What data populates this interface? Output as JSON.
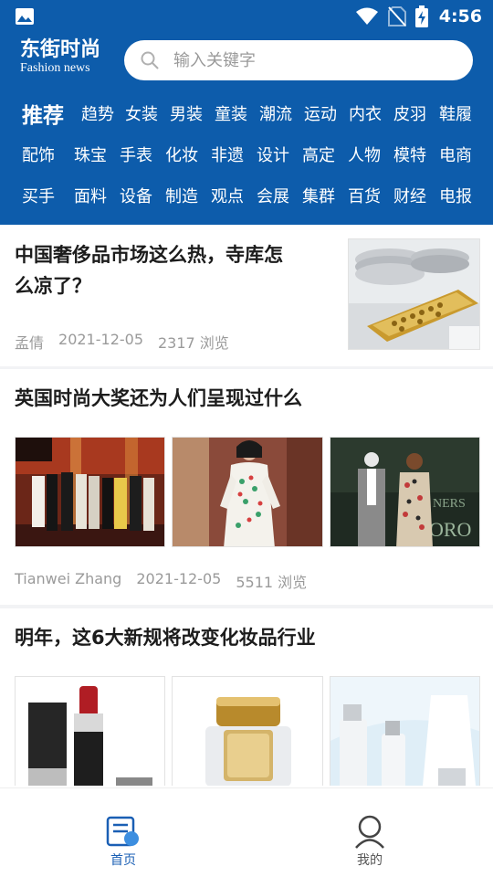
{
  "status_bar": {
    "time": "4:56",
    "icons": [
      "image-icon",
      "wifi-icon",
      "no-sim-icon",
      "battery-charging-icon"
    ]
  },
  "header": {
    "logo_cn": "东街时尚",
    "logo_en": "Fashion news",
    "search": {
      "placeholder": "输入关键字"
    },
    "categories": {
      "featured": "推荐",
      "row1": [
        "趋势",
        "女装",
        "男装",
        "童装",
        "潮流",
        "运动",
        "内衣",
        "皮羽",
        "鞋履"
      ],
      "row2": [
        "配饰",
        "珠宝",
        "手表",
        "化妆",
        "非遗",
        "设计",
        "高定",
        "人物",
        "模特",
        "电商"
      ],
      "row3": [
        "买手",
        "面料",
        "设备",
        "制造",
        "观点",
        "会展",
        "集群",
        "百货",
        "财经",
        "电报"
      ]
    }
  },
  "feed": [
    {
      "title_line1": "中国奢侈品市场这么热，寺库怎",
      "title_line2": "么凉了？",
      "author": "孟倩",
      "date": "2021-12-05",
      "views": "2317 浏览"
    },
    {
      "title": "英国时尚大奖还为人们呈现过什么",
      "author": "Tianwei Zhang",
      "date": "2021-12-05",
      "views": "5511 浏览"
    },
    {
      "title": "明年，这6大新规将改变化妆品行业"
    }
  ],
  "tabbar": {
    "items": [
      {
        "label": "首页",
        "icon": "home-news-icon",
        "active": true
      },
      {
        "label": "我的",
        "icon": "profile-icon",
        "active": false
      }
    ]
  },
  "colors": {
    "brand_blue": "#0d5cab",
    "active_tab": "#1a5fb4",
    "inactive_tab": "#555555",
    "meta_gray": "#9a9a9a"
  }
}
